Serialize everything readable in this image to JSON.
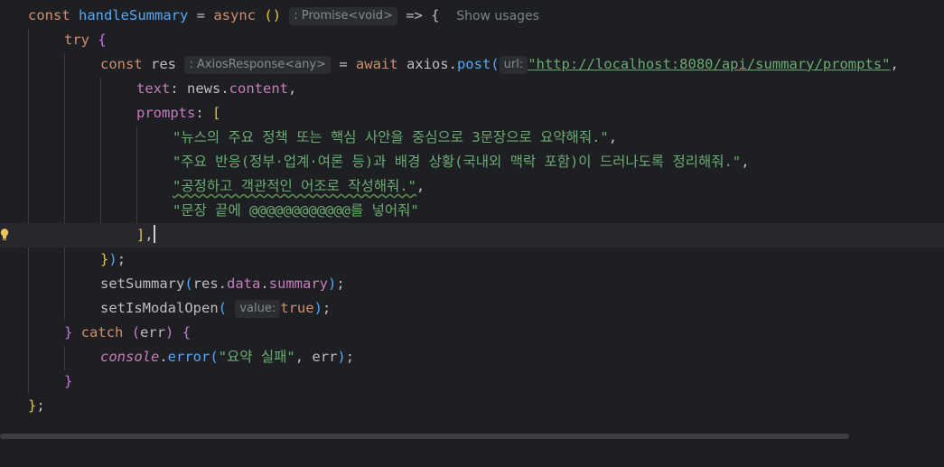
{
  "code": {
    "l1": {
      "decl": "const",
      "name": "handleSummary",
      "eq": " = ",
      "async": "async",
      "parens": "()",
      "hint": ": Promise<void>",
      "arrow": " => {",
      "usages": "Show usages"
    },
    "l2": {
      "try": "try",
      "brace": "{"
    },
    "l3": {
      "decl": "const",
      "name": "res",
      "hint": ": AxiosResponse<any>",
      "eq": " = ",
      "await": "await",
      "obj": "axios",
      "dot": ".",
      "method": "post",
      "paren": "(",
      "url_hint": "url:",
      "url": "\"http://localhost:8080/api/summary/prompts\"",
      "comma": ","
    },
    "l4": {
      "key": "text",
      "colon": ": ",
      "obj": "news",
      "dot": ".",
      "prop": "content",
      "comma": ","
    },
    "l5": {
      "key": "prompts",
      "colon": ": ",
      "bracket": "["
    },
    "l6": {
      "text": "\"뉴스의 주요 정책 또는 핵심 사안을 중심으로 3문장으로 요약해줘.\"",
      "comma": ","
    },
    "l7": {
      "text": "\"주요 반응(정부·업계·여론 등)과 배경 상황(국내외 맥락 포함)이 드러나도록 정리해줘.\"",
      "comma": ","
    },
    "l8": {
      "text": "\"공정하고 객관적인 어조로 작성해줘.\"",
      "comma": ","
    },
    "l9": {
      "text": "\"문장 끝에 @@@@@@@@@@@@를 넣어줘\""
    },
    "l10": {
      "bracket": "]",
      "comma": ","
    },
    "l11": {
      "close": "}",
      "paren": ")",
      "semi": ";"
    },
    "l12": {
      "fn": "setSummary",
      "paren": "(",
      "obj": "res",
      "dot1": ".",
      "p1": "data",
      "dot2": ".",
      "p2": "summary",
      "close": ")",
      "semi": ";"
    },
    "l13": {
      "fn": "setIsModalOpen",
      "paren": "(",
      "hint": "value:",
      "val": "true",
      "close": ")",
      "semi": ";"
    },
    "l14": {
      "close": "}",
      "catch": "catch",
      "paren": "(",
      "err": "err",
      "rparen": ")",
      "brace": "{"
    },
    "l15": {
      "console": "console",
      "dot": ".",
      "method": "error",
      "paren": "(",
      "msg": "\"요약 실패\"",
      "sep": ", ",
      "err": "err",
      "close": ")",
      "semi": ";"
    },
    "l16": {
      "close": "}"
    },
    "l17": {
      "close": "}",
      "semi": ";"
    }
  },
  "colors": {
    "background": "#1e1f22",
    "keyword": "#cf8e6d",
    "function": "#56a8f5",
    "property": "#c77dbb",
    "string": "#6aab73",
    "paren_level1": "#e4c54d",
    "paren_level2": "#c678dd"
  },
  "icons": {
    "gutter": "lightbulb-icon"
  }
}
